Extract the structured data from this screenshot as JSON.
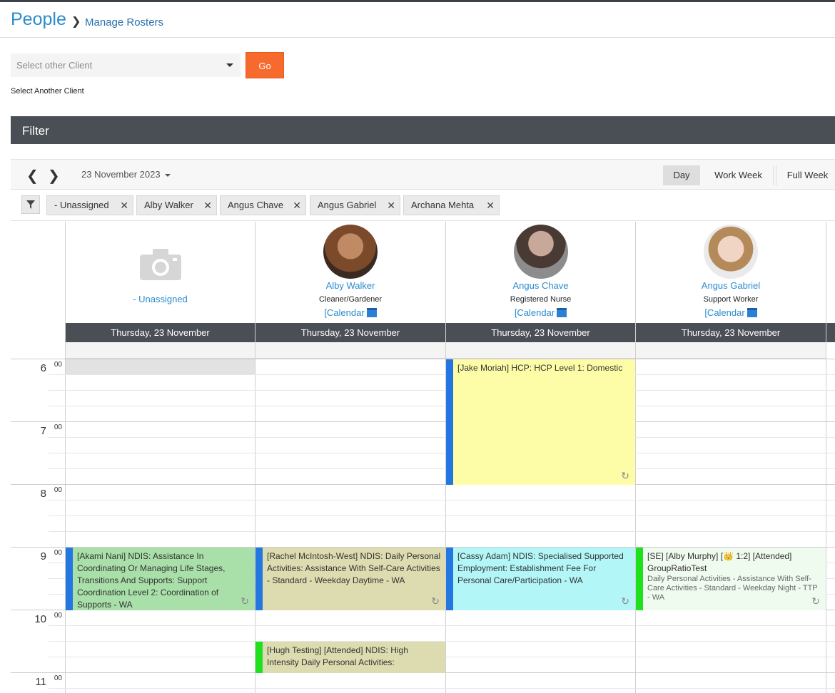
{
  "header": {
    "title": "People",
    "breadcrumb": "Manage Rosters"
  },
  "client_picker": {
    "placeholder": "Select other Client",
    "go_label": "Go",
    "help_text": "Select Another Client"
  },
  "filter": {
    "label": "Filter"
  },
  "toolbar": {
    "date": "23 November 2023",
    "views": [
      "Day",
      "Work Week",
      "Full Week"
    ],
    "active_view": "Day"
  },
  "chips": [
    "- Unassigned",
    "Alby Walker",
    "Angus Chave",
    "Angus Gabriel",
    "Archana Mehta"
  ],
  "resources": [
    {
      "name": "- Unassigned",
      "role": "",
      "calendar": "",
      "day": "Thursday, 23 November"
    },
    {
      "name": "Alby Walker",
      "role": "Cleaner/Gardener",
      "calendar": "[Calendar",
      "day": "Thursday, 23 November"
    },
    {
      "name": "Angus Chave",
      "role": "Registered Nurse",
      "calendar": "[Calendar",
      "day": "Thursday, 23 November"
    },
    {
      "name": "Angus Gabriel",
      "role": "Support Worker",
      "calendar": "[Calendar",
      "day": "Thursday, 23 November"
    }
  ],
  "hours": [
    {
      "h": "6",
      "m": "00"
    },
    {
      "h": "7",
      "m": "00"
    },
    {
      "h": "8",
      "m": "00"
    },
    {
      "h": "9",
      "m": "00"
    },
    {
      "h": "10",
      "m": "00"
    },
    {
      "h": "11",
      "m": "00"
    }
  ],
  "events": [
    {
      "title": "[Jake Moriah] HCP: HCP Level 1: Domestic",
      "sub": ""
    },
    {
      "title": "[Akami Nani] NDIS: Assistance In Coordinating Or Managing Life Stages, Transitions And Supports: Support Coordination Level 2: Coordination of Supports - WA",
      "sub": ""
    },
    {
      "title": "[Rachel McIntosh-West] NDIS: Daily Personal Activities: Assistance With Self-Care Activities - Standard - Weekday Daytime - WA",
      "sub": ""
    },
    {
      "title": "[Cassy Adam] NDIS: Specialised Supported Employment: Establishment Fee For Personal Care/Participation - WA",
      "sub": ""
    },
    {
      "title": "[SE] [Alby Murphy] [👑 1:2] [Attended] GroupRatioTest",
      "sub": "Daily Personal Activities - Assistance With Self-Care Activities - Standard - Weekday Night - TTP - WA"
    },
    {
      "title": "[Hugh Testing] [Attended] NDIS: High Intensity Daily Personal Activities:",
      "sub": ""
    }
  ],
  "colors": {
    "accent": "#2a8ccc",
    "go": "#f76a2e",
    "header_bar": "#4a4f56"
  }
}
